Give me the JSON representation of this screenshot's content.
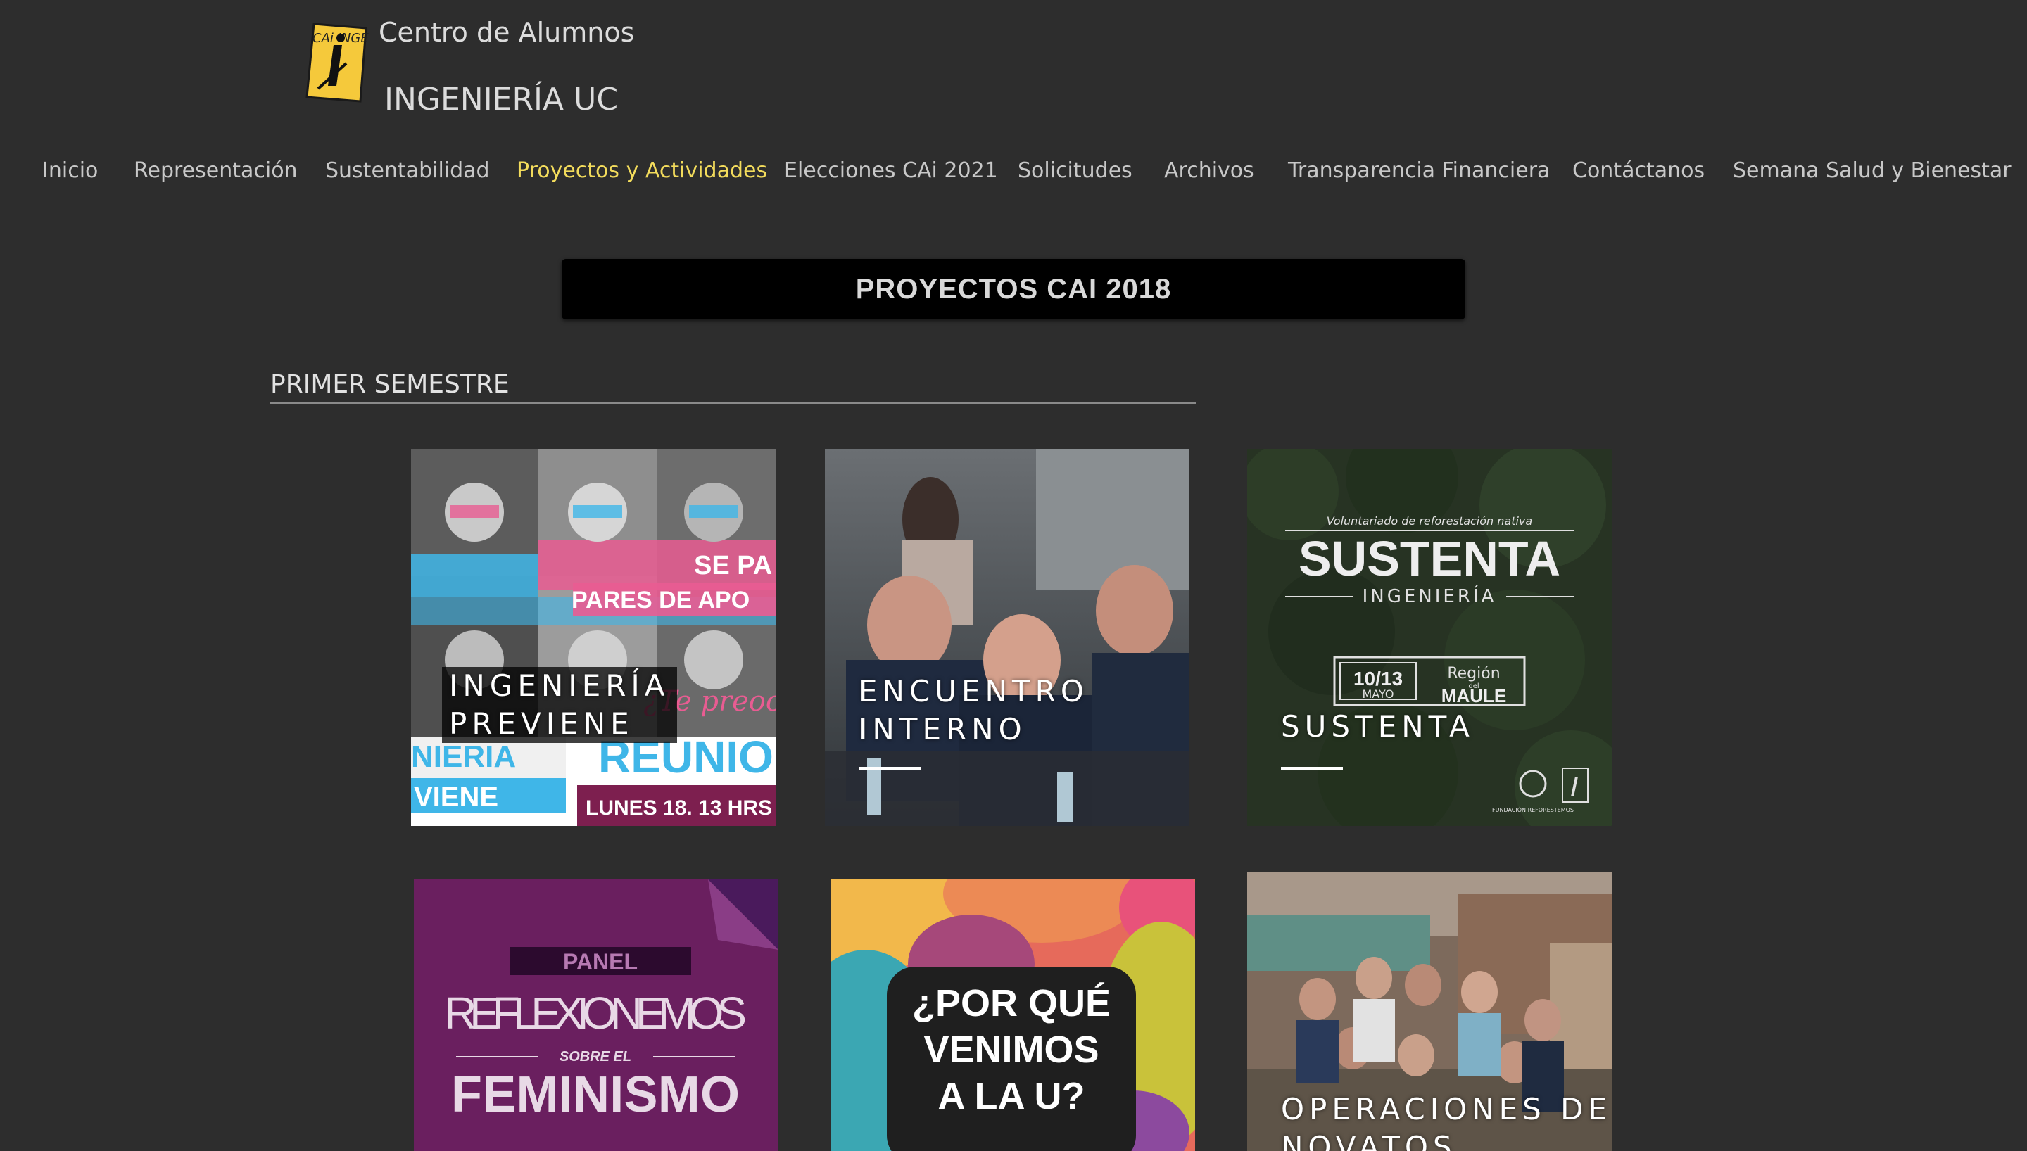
{
  "header": {
    "logo_icon": "cai-ingenieria-logo",
    "logo_text": "CAi INGENIERÍA",
    "subtitle": "Centro de Alumnos",
    "title": "INGENIERÍA UC"
  },
  "nav": {
    "items": [
      {
        "label": "Inicio"
      },
      {
        "label": "Representación"
      },
      {
        "label": "Sustentabilidad"
      },
      {
        "label": "Proyectos y Actividades",
        "active": true
      },
      {
        "label": "Elecciones CAi 2021"
      },
      {
        "label": "Solicitudes"
      },
      {
        "label": "Archivos"
      },
      {
        "label": "Transparencia Financiera"
      },
      {
        "label": "Contáctanos"
      },
      {
        "label": "Semana Salud y Bienestar"
      }
    ],
    "active_color": "#f3dc5c"
  },
  "banner": {
    "title": "PROYECTOS CAI 2018"
  },
  "section": {
    "heading": "PRIMER SEMESTRE"
  },
  "cards": [
    {
      "label_line1": "INGENIERÍA",
      "label_line2": "PREVIENE",
      "image": {
        "text1": "SE PA",
        "text2": "PARES DE APO",
        "text3": "¿Te preocupa",
        "text4": "NIERIA",
        "text5": "VIENE",
        "text6": "REUNIO",
        "text7": "LUNES 18. 13 HRS"
      }
    },
    {
      "label_line1": "ENCUENTRO",
      "label_line2": "INTERNO",
      "image": {
        "description_icon": "panel-discussion-photo"
      }
    },
    {
      "label_line1": "SUSTENTA",
      "image": {
        "tagline": "Voluntariado de reforestación nativa",
        "headline": "SUSTENTA",
        "sub": "INGENIERÍA",
        "date": "10/13",
        "month": "MAYO",
        "region_label": "Región",
        "region_prep": "del",
        "region_name": "MAULE",
        "footer": "FUNDACIÓN REFORESTEMOS"
      }
    },
    {
      "image": {
        "panel": "PANEL",
        "line1": "REFLEXIONEMOS",
        "line2": "SOBRE EL",
        "line3": "FEMINISMO"
      }
    },
    {
      "image": {
        "line1": "¿POR QUÉ",
        "line2": "VENIMOS",
        "line3": "A LA U?"
      }
    },
    {
      "label_line1": "OPERACIONES DE",
      "label_line2": "NOVATOS",
      "image": {
        "description_icon": "group-students-photo"
      }
    }
  ]
}
